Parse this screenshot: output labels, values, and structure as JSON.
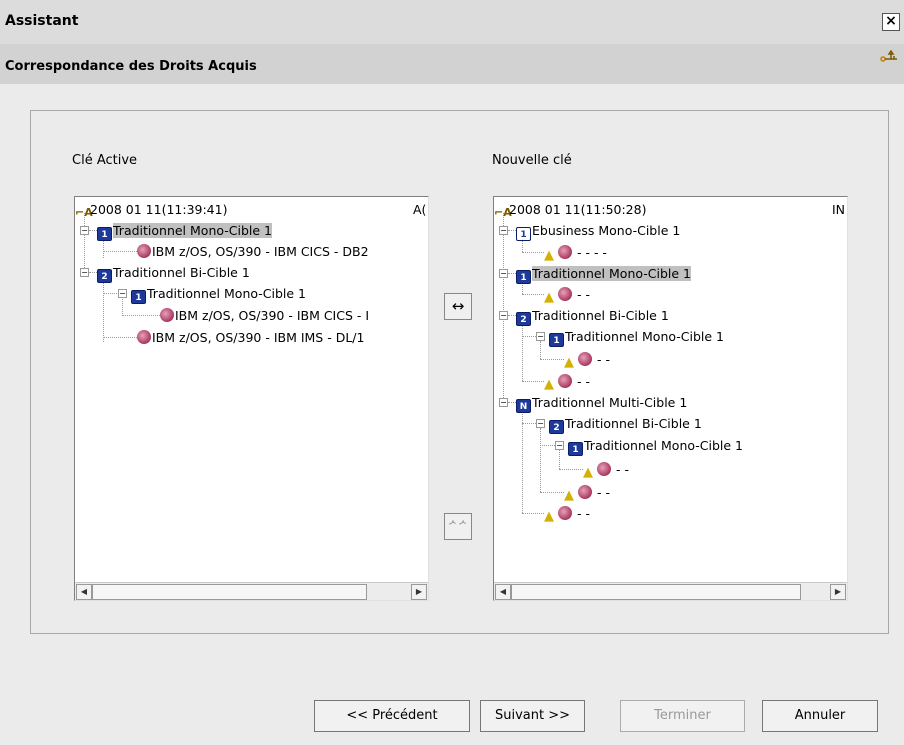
{
  "window": {
    "title": "Assistant",
    "close_glyph": "×",
    "subtitle": "Correspondance des Droits Acquis",
    "corner_icon": "key-icon"
  },
  "left": {
    "label": "Clé Active",
    "root": "2008 01 11(11:39:41)",
    "root_suffix": "A(",
    "items": [
      "Traditionnel Mono-Cible 1",
      "IBM z/OS, OS/390 - IBM CICS - DB2",
      "Traditionnel Bi-Cible 1",
      "Traditionnel Mono-Cible 1",
      "IBM z/OS, OS/390 - IBM CICS - I",
      "IBM z/OS, OS/390 - IBM IMS - DL/1"
    ]
  },
  "right": {
    "label": "Nouvelle clé",
    "root": "2008 01 11(11:50:28)",
    "root_suffix": "IN",
    "items": [
      "Ebusiness Mono-Cible 1",
      "- - - -",
      "Traditionnel Mono-Cible 1",
      "- -",
      "Traditionnel Bi-Cible 1",
      "Traditionnel Mono-Cible 1",
      "- -",
      "- -",
      "Traditionnel Multi-Cible 1",
      "Traditionnel Bi-Cible 1",
      "Traditionnel Mono-Cible 1",
      "- -",
      "- -",
      "- -"
    ]
  },
  "icon_badges": {
    "one": "1",
    "two": "2",
    "n": "N"
  },
  "controls": {
    "map_glyph": "↔",
    "unmap_glyph": "ᄼᄼ"
  },
  "buttons": {
    "prev": "<< Précédent",
    "next": "Suivant >>",
    "finish": "Terminer",
    "cancel": "Annuler"
  },
  "colors": {
    "titlebar": "#dcdcdc",
    "subbar": "#d2d2d2",
    "panel": "#ebebeb",
    "selection": "#c0c0c0",
    "target_icon": "#1d3a9a"
  }
}
